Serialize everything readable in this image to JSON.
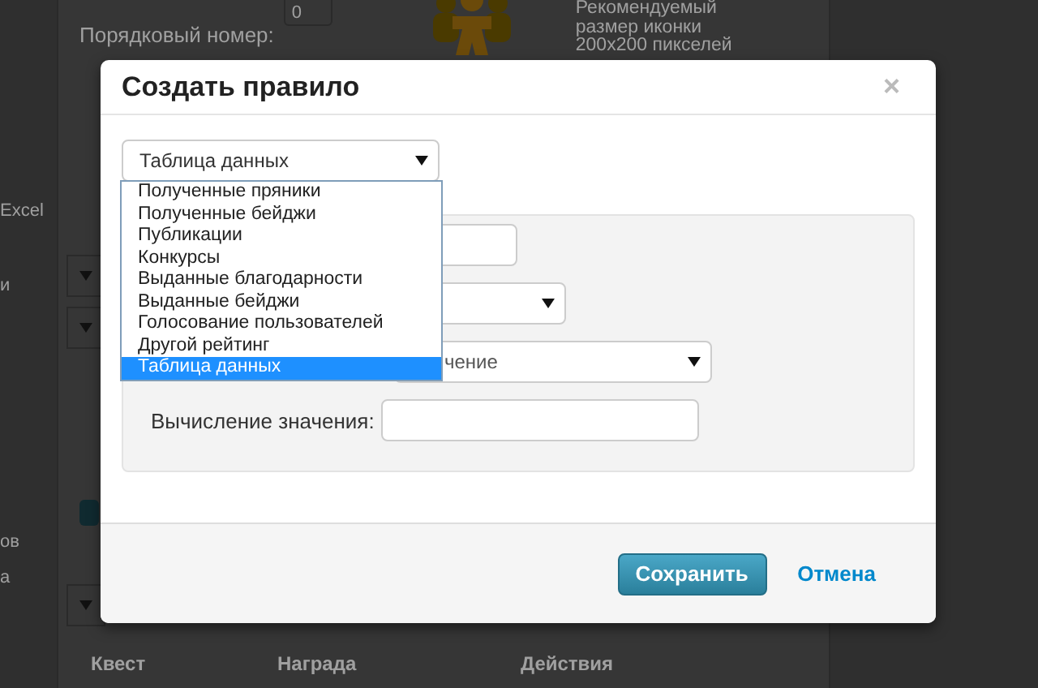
{
  "background_page": {
    "order_label": "Порядковый номер:",
    "order_value": "0",
    "icon_hint": "Рекомендуемый размер иконки 200x200 пикселей",
    "side_fragments": [
      "Excel",
      "и",
      "ов",
      "а"
    ],
    "table_columns": [
      "Квест",
      "Награда",
      "Действия"
    ]
  },
  "dialog": {
    "title": "Создать правило",
    "close": "×",
    "source_select": {
      "value": "Таблица данных",
      "expanded": true,
      "options": [
        {
          "label": "Полученные пряники",
          "selected": false
        },
        {
          "label": "Полученные бейджи",
          "selected": false
        },
        {
          "label": "Публикации",
          "selected": false
        },
        {
          "label": "Конкурсы",
          "selected": false
        },
        {
          "label": "Выданные благодарности",
          "selected": false
        },
        {
          "label": "Выданные бейджи",
          "selected": false
        },
        {
          "label": "Голосование пользователей",
          "selected": false
        },
        {
          "label": "Другой рейтинг",
          "selected": false
        },
        {
          "label": "Таблица данных",
          "selected": true
        }
      ]
    },
    "fields": [
      {
        "kind": "input"
      },
      {
        "kind": "select"
      },
      {
        "kind": "select",
        "value": "чение"
      },
      {
        "kind": "input",
        "label": "Вычисление значения:"
      }
    ],
    "buttons": {
      "save": "Сохранить",
      "cancel": "Отмена"
    }
  }
}
